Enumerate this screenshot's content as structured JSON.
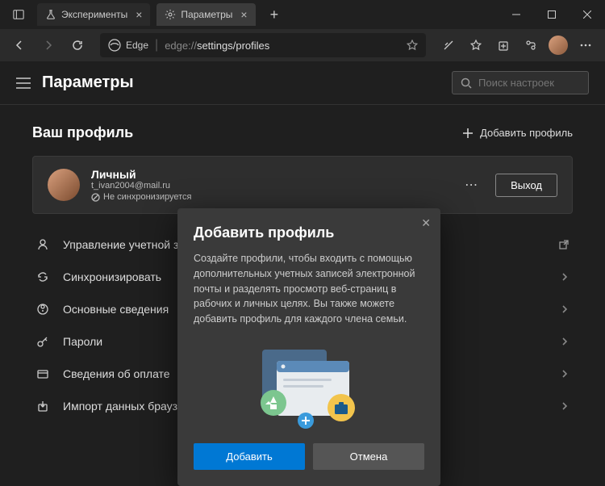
{
  "tabs": [
    {
      "label": "Эксперименты",
      "icon": "flask-icon"
    },
    {
      "label": "Параметры",
      "icon": "gear-icon"
    }
  ],
  "address": {
    "brand": "Edge",
    "url_host": "edge://",
    "url_path1": "settings/",
    "url_path2": "profiles"
  },
  "page": {
    "title": "Параметры",
    "search_placeholder": "Поиск настроек"
  },
  "profile_section": {
    "title": "Ваш профиль",
    "add_label": "Добавить профиль"
  },
  "profile": {
    "name": "Личный",
    "email": "t_ivan2004@mail.ru",
    "sync_status": "Не синхронизируется",
    "signout": "Выход"
  },
  "settings_items": [
    {
      "label": "Управление учетной зап",
      "icon": "person-icon",
      "external": true
    },
    {
      "label": "Синхронизировать",
      "icon": "sync-icon",
      "external": false
    },
    {
      "label": "Основные сведения",
      "icon": "info-icon",
      "external": false
    },
    {
      "label": "Пароли",
      "icon": "key-icon",
      "external": false
    },
    {
      "label": "Сведения об оплате",
      "icon": "card-icon",
      "external": false
    },
    {
      "label": "Импорт данных браузер",
      "icon": "import-icon",
      "external": false
    }
  ],
  "modal": {
    "title": "Добавить профиль",
    "text": "Создайте профили, чтобы входить с помощью дополнительных учетных записей электронной почты и разделять просмотр веб-страниц в рабочих и личных целях. Вы также можете добавить профиль для каждого члена семьи.",
    "add": "Добавить",
    "cancel": "Отмена"
  }
}
